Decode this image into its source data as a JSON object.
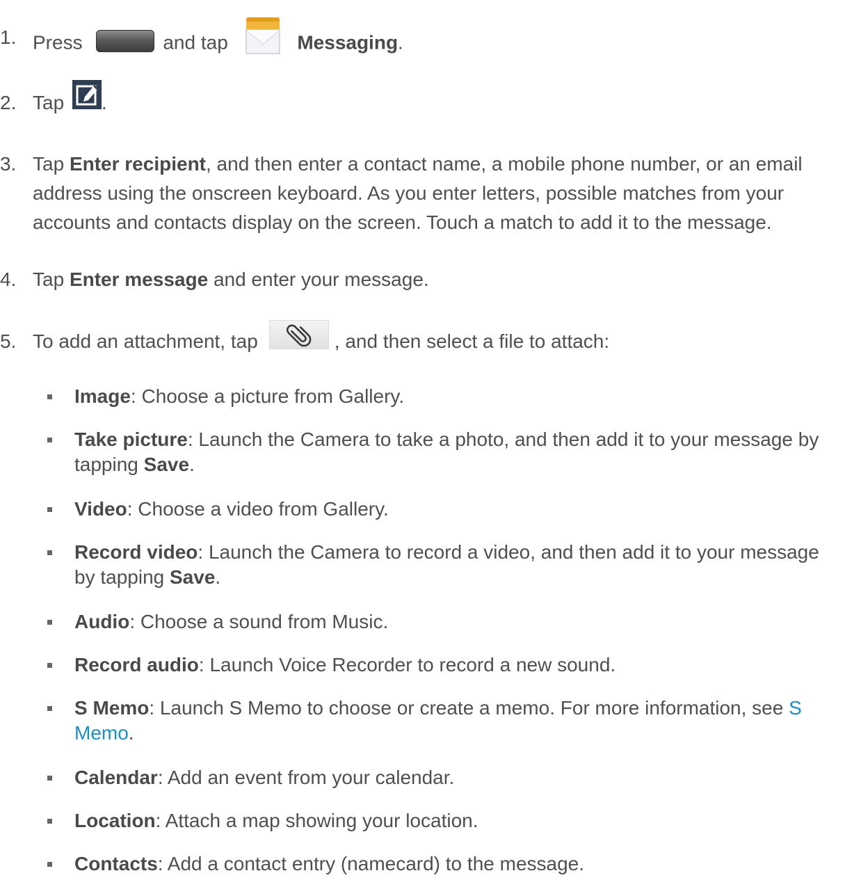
{
  "steps": [
    {
      "num": "1.",
      "pre": "Press",
      "mid": "and tap",
      "bold": "Messaging",
      "post": "."
    },
    {
      "num": "2.",
      "pre": "Tap",
      "post": "."
    },
    {
      "num": "3.",
      "pre": "Tap",
      "bold": "Enter recipient",
      "post": ", and then enter a contact name, a mobile phone number, or an email address using the onscreen keyboard. As you enter letters, possible matches from your accounts and contacts display on the screen. Touch a match to add it to the message."
    },
    {
      "num": "4.",
      "pre": "Tap",
      "bold": "Enter message",
      "post": "and enter your message."
    },
    {
      "num": "5.",
      "pre": "To add an attachment, tap",
      "post": ", and then select a file to attach:"
    }
  ],
  "attachments": [
    {
      "term": "Image",
      "desc": ": Choose a picture from Gallery."
    },
    {
      "term": "Take picture",
      "desc": ": Launch the Camera to take a photo, and then add it to your message by tapping",
      "bold2": "Save",
      "end": "."
    },
    {
      "term": "Video",
      "desc": ": Choose a video from Gallery."
    },
    {
      "term": "Record video",
      "desc": ": Launch the Camera to record a video, and then add it to your message by tapping",
      "bold2": "Save",
      "end": "."
    },
    {
      "term": "Audio",
      "desc": ": Choose a sound from Music."
    },
    {
      "term": "Record audio",
      "desc": ": Launch Voice Recorder to record a new sound."
    },
    {
      "term": "S Memo",
      "desc": ": Launch S Memo to choose or create a memo. For more information, see",
      "link": "S Memo",
      "end": "."
    },
    {
      "term": "Calendar",
      "desc": ": Add an event from your calendar."
    },
    {
      "term": "Location",
      "desc": ": Attach a map showing your location."
    },
    {
      "term": "Contacts",
      "desc": ": Add a contact entry (namecard) to the message."
    }
  ],
  "icons": {
    "home_key": "home-key-icon",
    "messaging": "messaging-envelope-icon",
    "compose": "compose-icon",
    "attach": "paperclip-icon"
  },
  "colors": {
    "text": "#4f4f4f",
    "link": "#1a8fc4",
    "compose_bg": "#2e3d52",
    "envelope_flap": "#f2b53c"
  }
}
